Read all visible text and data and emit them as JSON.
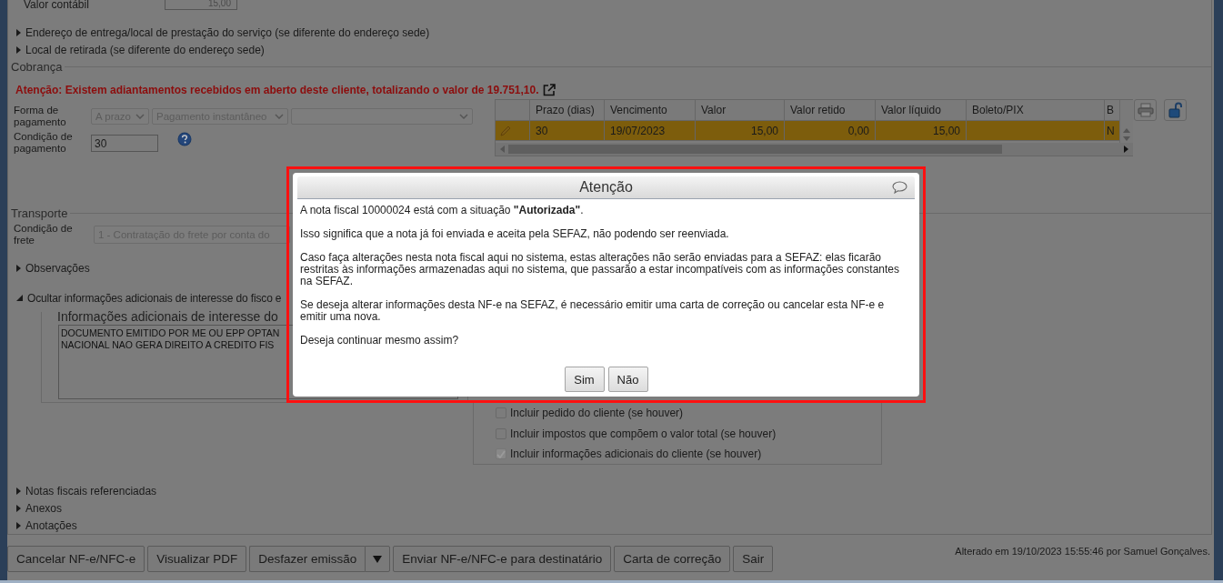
{
  "top_field": {
    "label": "Valor contábil",
    "value": "15,00"
  },
  "expanders_top": [
    {
      "label": "Endereço de entrega/local de prestação do serviço (se diferente do endereço sede)",
      "expanded": false
    },
    {
      "label": "Local de retirada (se diferente do endereço sede)",
      "expanded": false
    }
  ],
  "cobranca": {
    "legend": "Cobrança",
    "warning": "Atenção: Existem adiantamentos recebidos em aberto deste cliente, totalizando o valor de 19.751,10.",
    "payment_form": {
      "label": "Forma de pagamento",
      "selects": [
        "A prazo",
        "Pagamento instantâneo"
      ]
    },
    "payment_condition": {
      "label": "Condição de pagamento",
      "value": "30"
    },
    "installments": {
      "columns": [
        "Prazo (dias)",
        "Vencimento",
        "Valor",
        "Valor retido",
        "Valor líquido",
        "Boleto/PIX",
        "B"
      ],
      "rows": [
        {
          "cells": [
            "30",
            "19/07/2023",
            "15,00",
            "0,00",
            "15,00",
            null,
            "N"
          ],
          "selected": true
        }
      ]
    }
  },
  "transporte": {
    "legend": "Transporte",
    "freight": {
      "label": "Condição de frete",
      "value": "1 - Contratação do frete por conta do"
    }
  },
  "expanders_mid": [
    {
      "label": "Observações",
      "expanded": false
    },
    {
      "label": "Ocultar informações adicionais de interesse do fisco e",
      "expanded": true
    }
  ],
  "additional_info": {
    "legend": "Informações adicionais de interesse do",
    "lines": [
      "DOCUMENTO EMITIDO POR ME OU EPP OPTAN",
      "NACIONAL NAO GERA DIREITO A CREDITO FIS"
    ]
  },
  "include_options": [
    {
      "label": "Incluir pedido do cliente (se houver)",
      "checked": false,
      "disabled": false
    },
    {
      "label": "Incluir impostos que compõem o valor total (se houver)",
      "checked": false,
      "disabled": false
    },
    {
      "label": "Incluir informações adicionais do cliente (se houver)",
      "checked": true,
      "disabled": true
    }
  ],
  "expanders_bottom": [
    {
      "label": "Notas fiscais referenciadas",
      "expanded": false
    },
    {
      "label": "Anexos",
      "expanded": false
    },
    {
      "label": "Anotações",
      "expanded": false
    }
  ],
  "actions": [
    {
      "label": "Cancelar NF-e/NFC-e",
      "kind": "plain"
    },
    {
      "label": "Visualizar PDF",
      "kind": "plain"
    },
    {
      "label": "Desfazer emissão",
      "kind": "split"
    },
    {
      "label": "Enviar NF-e/NFC-e para destinatário",
      "kind": "plain"
    },
    {
      "label": "Carta de correção",
      "kind": "plain"
    },
    {
      "label": "Sair",
      "kind": "plain"
    }
  ],
  "modified_note": "Alterado em 19/10/2023 15:55:46 por Samuel Gonçalves.",
  "dialog": {
    "title": "Atenção",
    "paragraphs": [
      "A nota fiscal 10000024 está com a situação **\"Autorizada\"**.",
      "Isso significa que a nota já foi enviada e aceita pela SEFAZ, não podendo ser reenviada.",
      "Caso faça alterações nesta nota fiscal aqui no sistema, estas alterações não serão enviadas para a SEFAZ: elas ficarão restritas às informações armazenadas aqui no sistema, que passarão a estar incompatíveis com as informações constantes na SEFAZ.",
      "Se deseja alterar informações desta NF-e na SEFAZ, é necessário emitir uma carta de correção ou cancelar esta NF-e e emitir uma nova.",
      "Deseja continuar mesmo assim?"
    ],
    "buttons": [
      "Sim",
      "Não"
    ]
  }
}
